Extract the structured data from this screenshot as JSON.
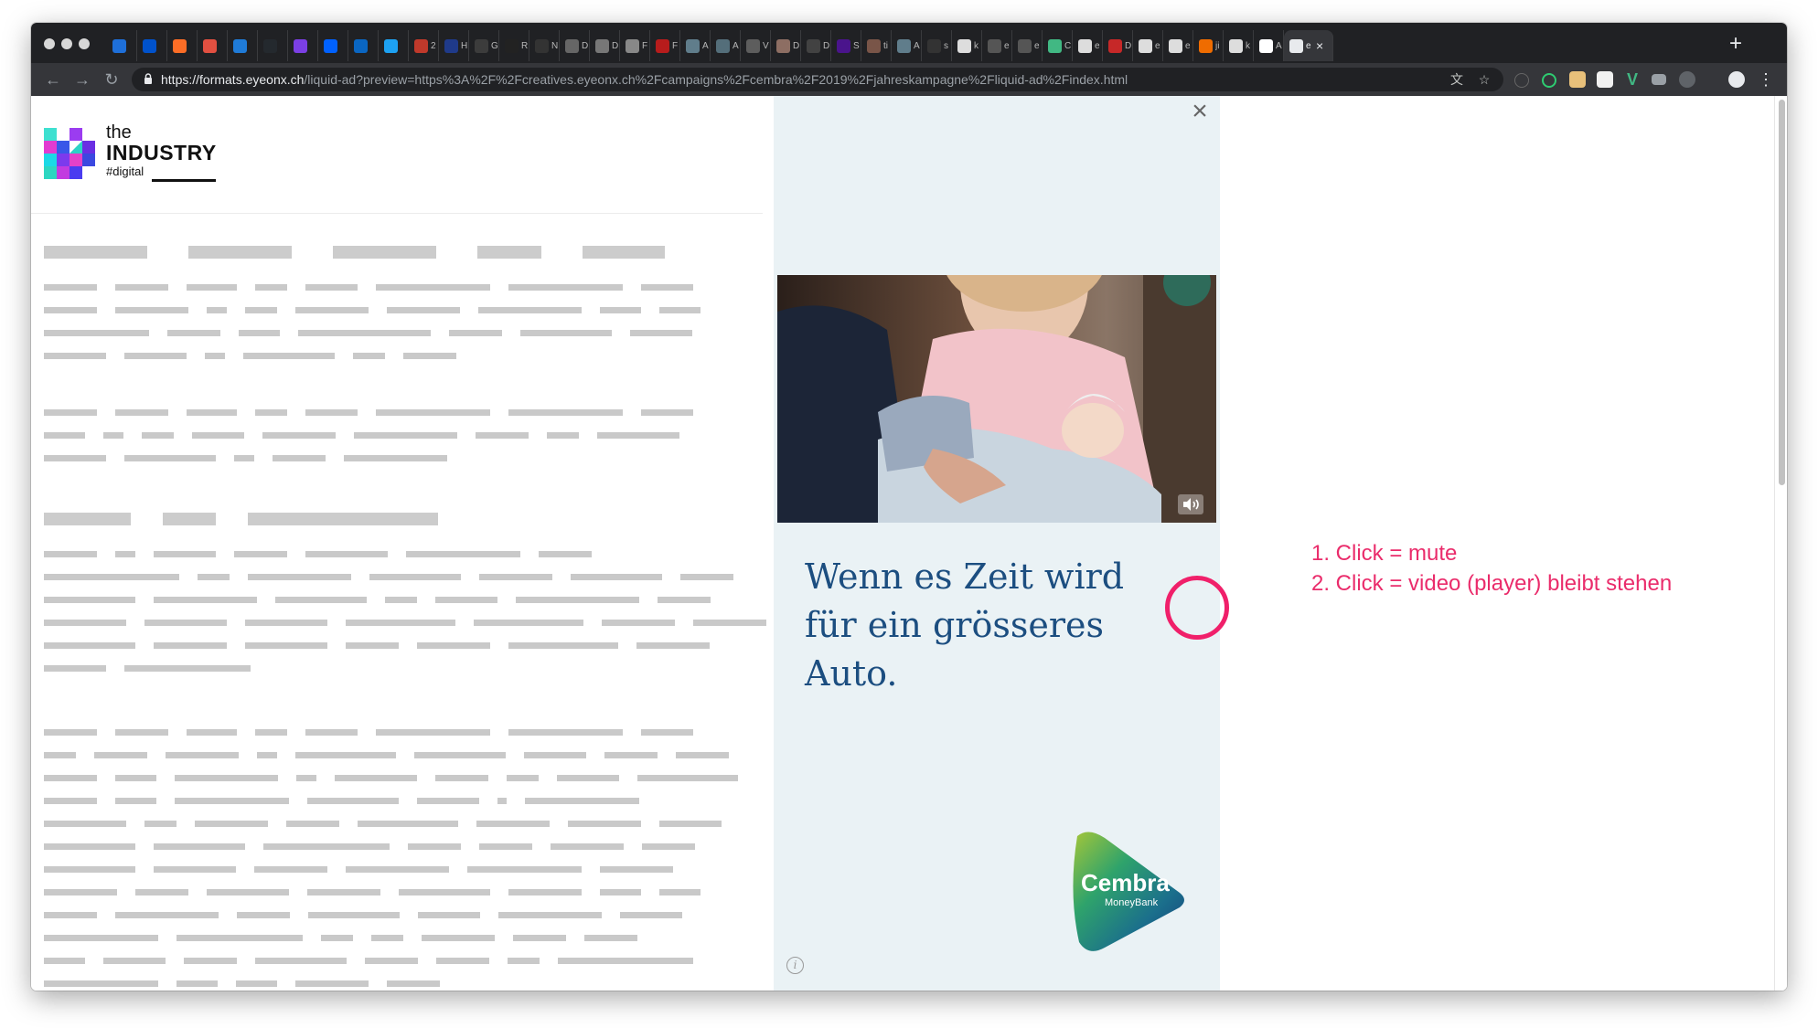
{
  "browser": {
    "url_host": "https://formats.eyeonx.ch",
    "url_path": "/liquid-ad?preview=https%3A%2F%2Fcreatives.eyeonx.ch%2Fcampaigns%2Fcembra%2F2019%2Fjahreskampagne%2Fliquid-ad%2Findex.html",
    "active_tab_label": "e",
    "tabs": [
      {
        "label": "",
        "color": "#1e6fd9"
      },
      {
        "label": "",
        "color": "#0052cc"
      },
      {
        "label": "",
        "color": "#fc6d26"
      },
      {
        "label": "",
        "color": "#e25041"
      },
      {
        "label": "",
        "color": "#1f7bd8"
      },
      {
        "label": "",
        "color": "#24292e"
      },
      {
        "label": "",
        "color": "#7b3fe4"
      },
      {
        "label": "",
        "color": "#0061fe"
      },
      {
        "label": "",
        "color": "#0a66c2"
      },
      {
        "label": "",
        "color": "#1da1f2"
      },
      {
        "label": "2",
        "color": "#c0392b"
      },
      {
        "label": "H",
        "color": "#1f3a8a"
      },
      {
        "label": "G",
        "color": "#3c3c3c"
      },
      {
        "label": "R",
        "color": "#222222"
      },
      {
        "label": "N",
        "color": "#333333"
      },
      {
        "label": "D",
        "color": "#666666"
      },
      {
        "label": "D",
        "color": "#777777"
      },
      {
        "label": "F",
        "color": "#888888"
      },
      {
        "label": "F",
        "color": "#b71c1c"
      },
      {
        "label": "A",
        "color": "#607d8b"
      },
      {
        "label": "A",
        "color": "#546e7a"
      },
      {
        "label": "V",
        "color": "#5d5d5d"
      },
      {
        "label": "D",
        "color": "#8d6e63"
      },
      {
        "label": "D",
        "color": "#424242"
      },
      {
        "label": "S",
        "color": "#4a148c"
      },
      {
        "label": "ti",
        "color": "#795548"
      },
      {
        "label": "A",
        "color": "#607d8b"
      },
      {
        "label": "s",
        "color": "#333333"
      },
      {
        "label": "k",
        "color": "#dddddd"
      },
      {
        "label": "e",
        "color": "#555555"
      },
      {
        "label": "e",
        "color": "#555555"
      },
      {
        "label": "C",
        "color": "#41b883"
      },
      {
        "label": "e",
        "color": "#dddddd"
      },
      {
        "label": "D",
        "color": "#c62828"
      },
      {
        "label": "e",
        "color": "#dddddd"
      },
      {
        "label": "e",
        "color": "#dddddd"
      },
      {
        "label": "ji",
        "color": "#ef6c00"
      },
      {
        "label": "k",
        "color": "#dddddd"
      },
      {
        "label": "A",
        "color": "#ffffff"
      }
    ]
  },
  "page": {
    "logo": {
      "the": "the",
      "industry": "INDUSTRY",
      "digital": "#digital"
    }
  },
  "ad": {
    "headline_line1": "Wenn es Zeit wird",
    "headline_line2": "für ein grösseres Auto.",
    "brand": "Cembra",
    "brand_sub": "MoneyBank",
    "info": "i"
  },
  "annotation": {
    "note1": "1. Click = mute",
    "note2": "2. Click = video (player) bleibt stehen",
    "color": "#ea2c6b"
  }
}
